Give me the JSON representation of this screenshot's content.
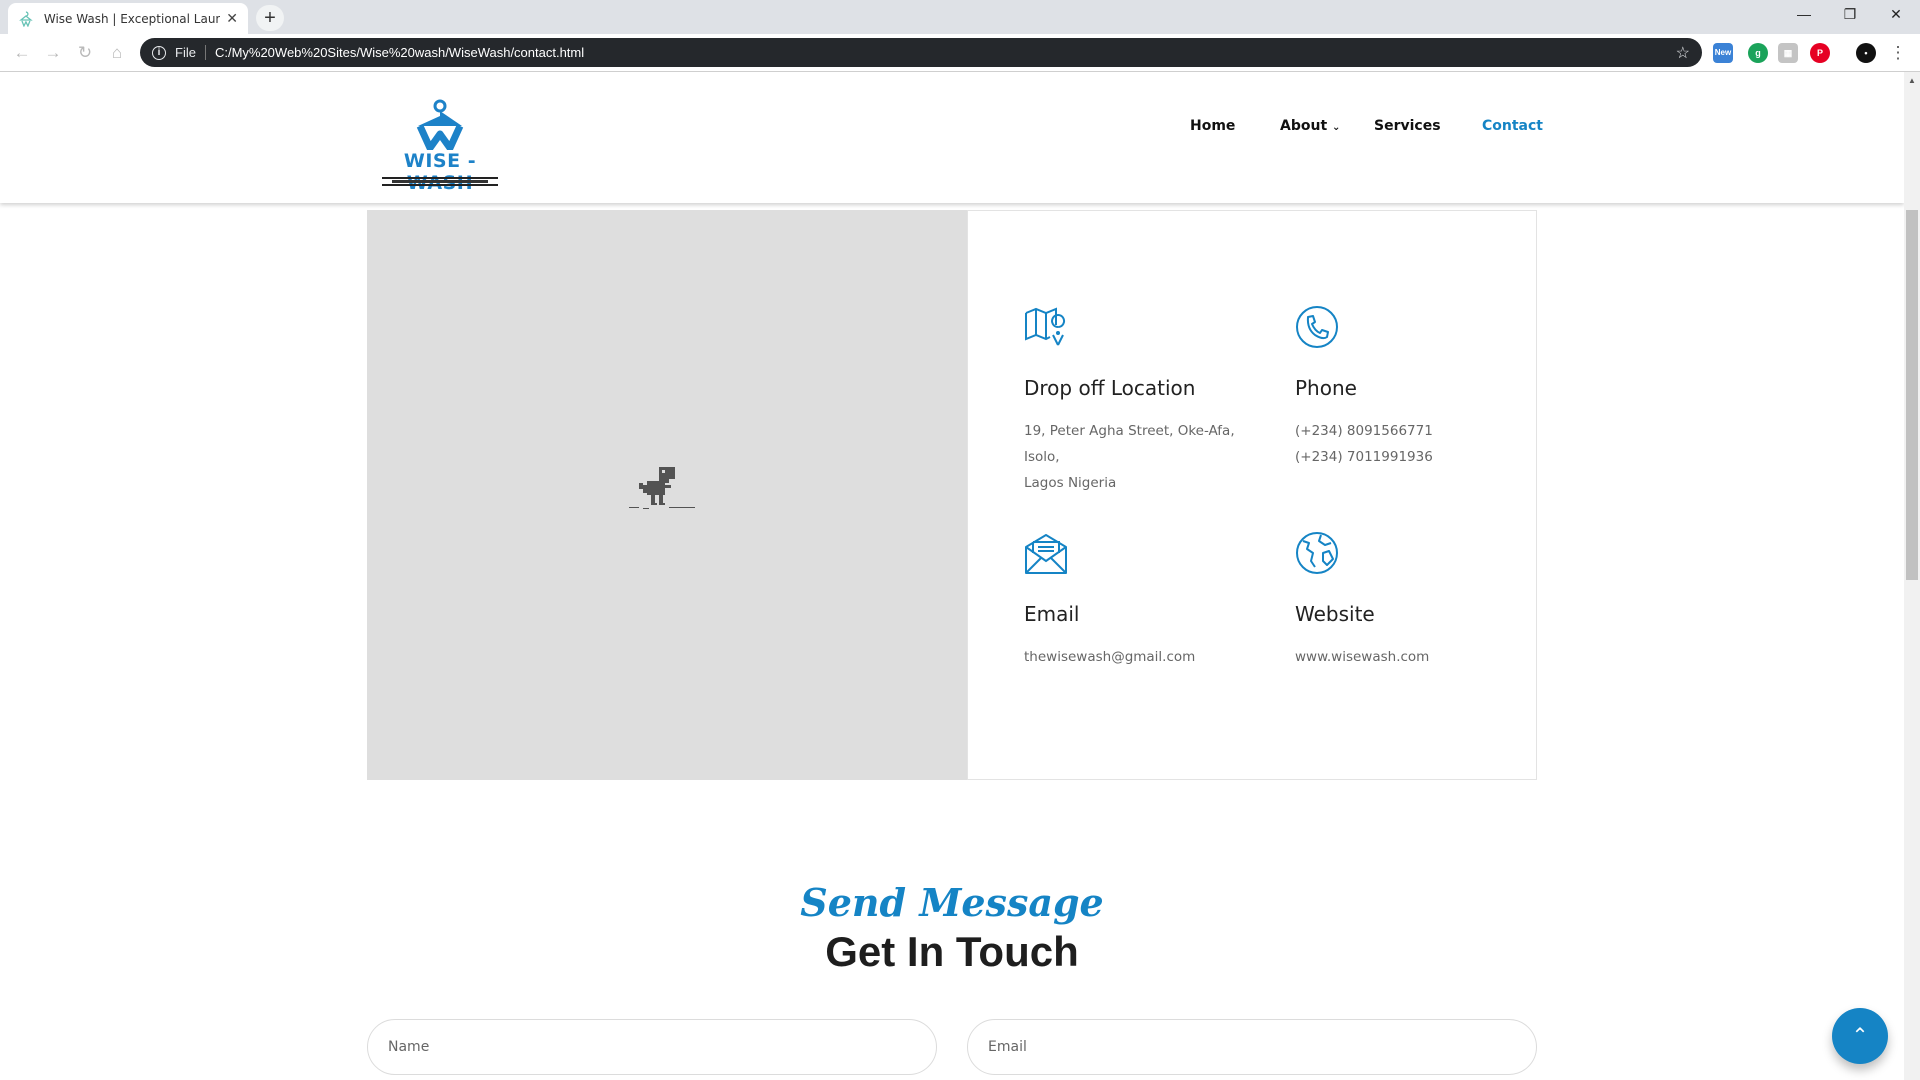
{
  "browser": {
    "tab_title": "Wise Wash | Exceptional Laundry",
    "tab_close": "✕",
    "new_tab": "+",
    "file_label": "File",
    "url": "C:/My%20Web%20Sites/Wise%20wash/WiseWash/contact.html",
    "ext_new_label": "New"
  },
  "site": {
    "logo_text": "WISE - WASH",
    "nav": {
      "home": "Home",
      "about": "About",
      "services": "Services",
      "contact": "Contact"
    },
    "accent_color": "#1584c5"
  },
  "contact": {
    "location": {
      "icon": "map-pin-icon",
      "title": "Drop off Location",
      "line1": "19, Peter Agha Street, Oke-Afa, Isolo,",
      "line2": "Lagos Nigeria"
    },
    "phone": {
      "icon": "phone-icon",
      "title": "Phone",
      "line1": "(+234) 8091566771",
      "line2": "(+234) 7011991936"
    },
    "email": {
      "icon": "envelope-icon",
      "title": "Email",
      "line1": "thewisewash@gmail.com"
    },
    "website": {
      "icon": "globe-icon",
      "title": "Website",
      "line1": "www.wisewash.com"
    }
  },
  "form": {
    "subtitle": "Send Message",
    "title": "Get In Touch",
    "name_placeholder": "Name",
    "email_placeholder": "Email"
  }
}
